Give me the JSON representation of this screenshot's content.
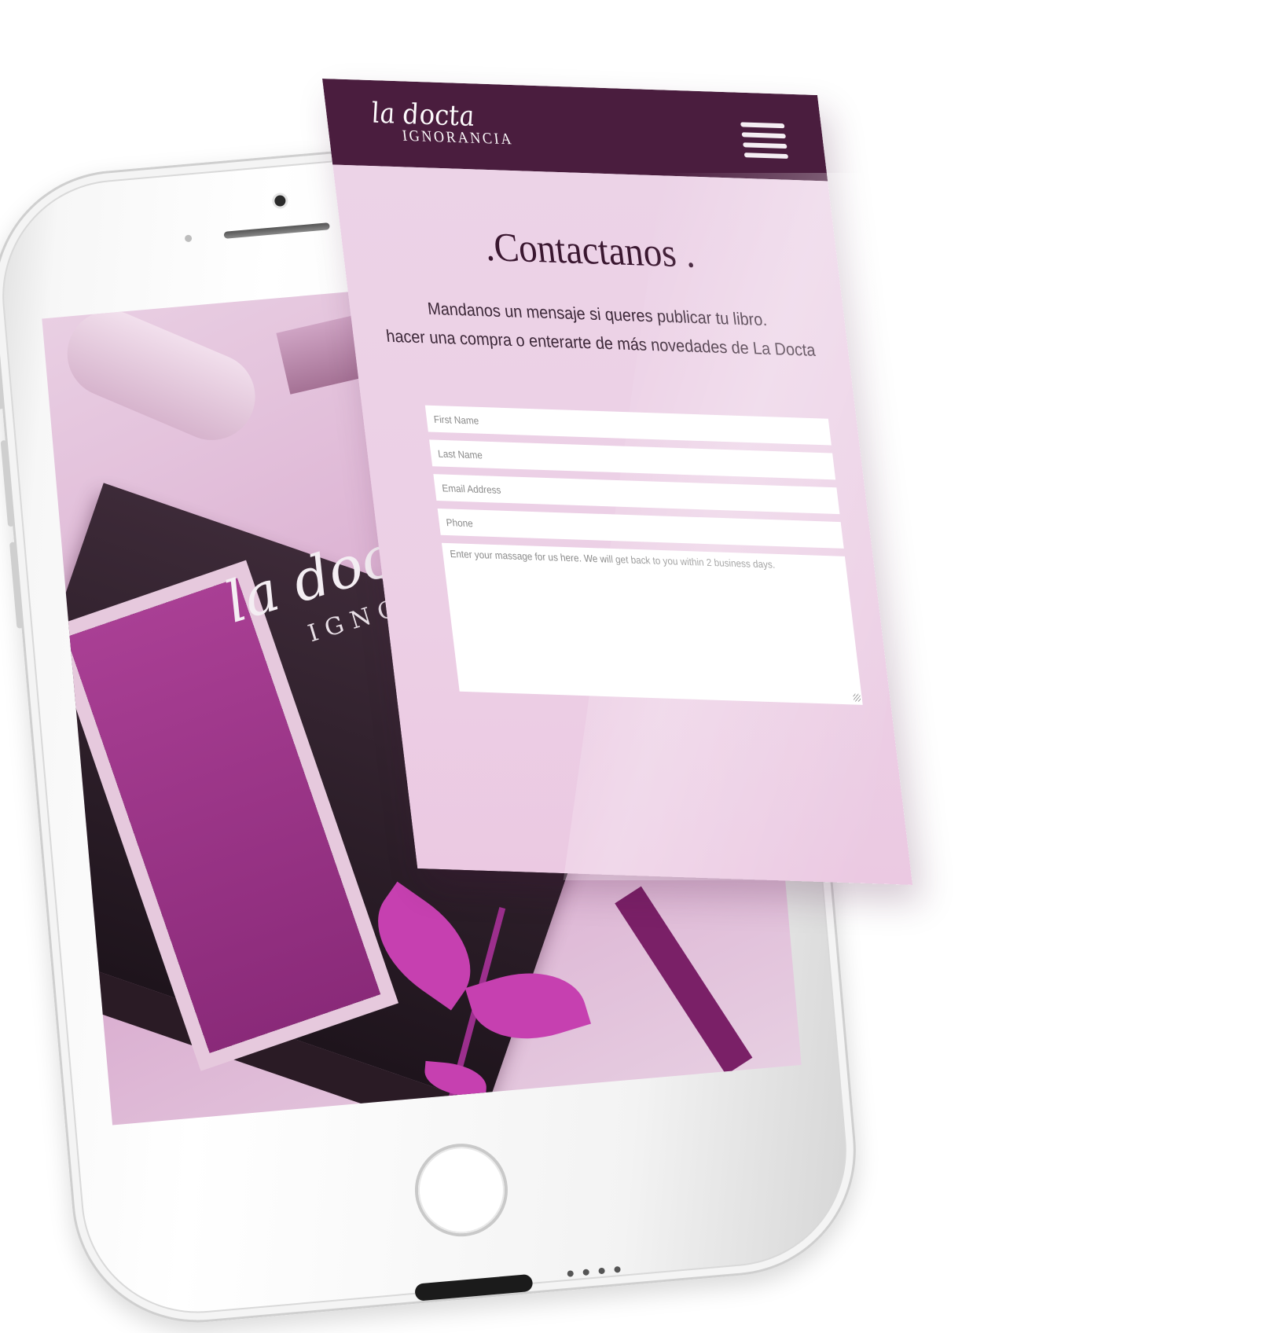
{
  "brand": {
    "script": "la docta",
    "caps": "IGNORANCIA"
  },
  "screen_logo": {
    "script": "la docta",
    "caps": "IGNORANCIA"
  },
  "contact": {
    "title": ".Contactanos .",
    "subtitle_line1": "Mandanos un mensaje si queres publicar tu libro.",
    "subtitle_line2": "hacer una compra o enterarte de más novedades de La Docta"
  },
  "form": {
    "first_name_placeholder": "First Name",
    "last_name_placeholder": "Last Name",
    "email_placeholder": "Email Address",
    "phone_placeholder": "Phone",
    "message_placeholder": "Enter your massage for us here. We will get back to you within 2 business days."
  },
  "icons": {
    "menu": "hamburger-menu-icon",
    "home": "home-button-icon"
  },
  "colors": {
    "header": "#4a1d3e",
    "page_background": "#ecd3e7",
    "title": "#3a1730",
    "accent": "#c640b0"
  }
}
